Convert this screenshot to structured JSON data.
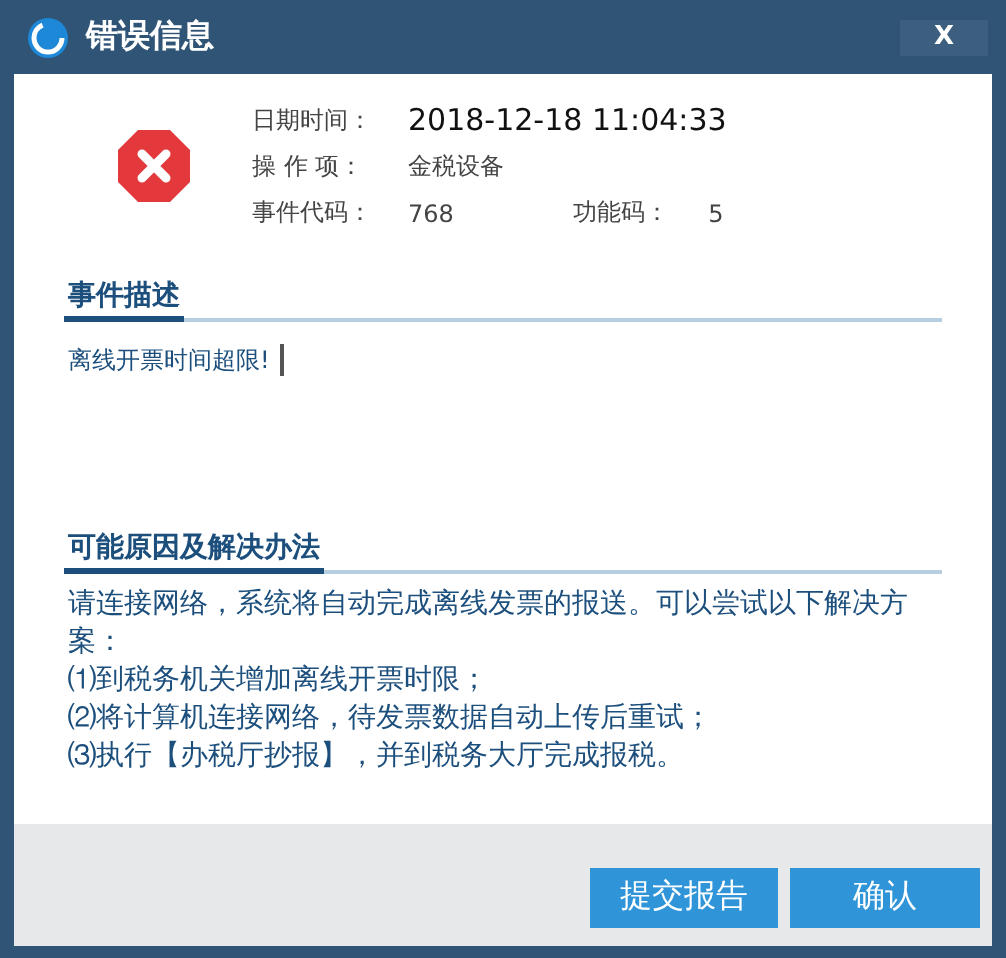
{
  "window": {
    "title": "错误信息",
    "close": "X"
  },
  "info": [
    {
      "label": "日期时间：",
      "value": "2018-12-18 11:04:33"
    },
    {
      "label": "操 作 项：",
      "value": "金税设备"
    },
    {
      "label": "事件代码：",
      "value": "768",
      "extra_label": "功能码：",
      "extra_value": "5"
    }
  ],
  "event": {
    "heading": "事件描述",
    "text": "离线开票时间超限!"
  },
  "solution": {
    "heading": "可能原因及解决办法",
    "lines": [
      "请连接网络，系统将自动完成离线发票的报送。可以尝试以下解决方案：",
      "⑴到税务机关增加离线开票时限；",
      "⑵将计算机连接网络，待发票数据自动上传后重试；",
      "⑶执行【办税厅抄报】，并到税务大厅完成报税。"
    ]
  },
  "buttons": [
    "提交报告",
    "确认"
  ]
}
